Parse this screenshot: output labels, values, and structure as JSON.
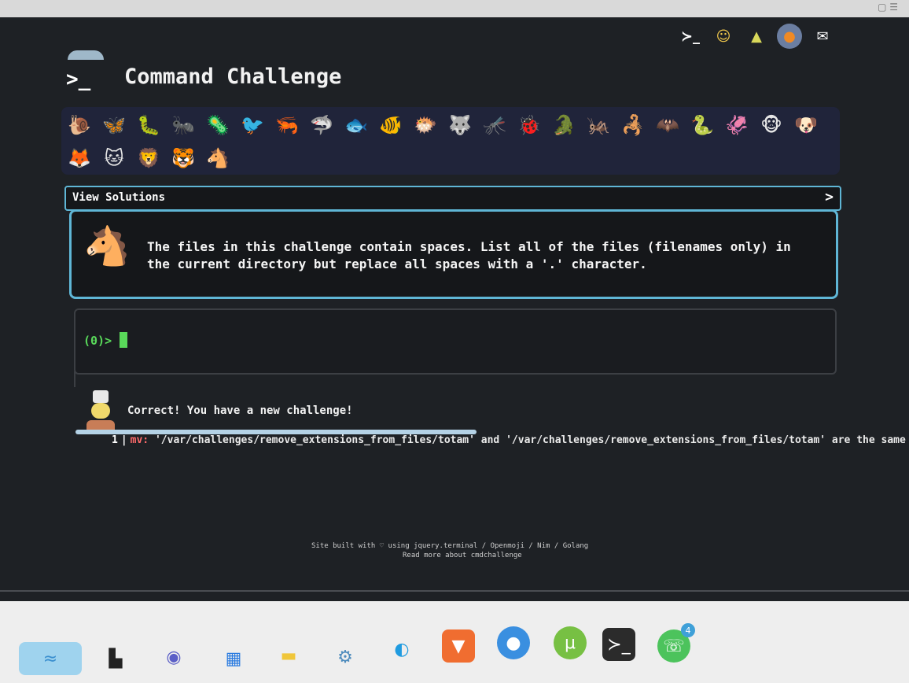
{
  "topbar": {
    "icons": [
      "terminal-icon",
      "emoji-icon",
      "tree-icon",
      "fox-badge-icon",
      "mail-icon"
    ]
  },
  "app": {
    "logo_prompt": ">_",
    "title": "Command Challenge"
  },
  "emoji_bar": {
    "row1": [
      "🐌",
      "🦋",
      "🐛",
      "🐜",
      "🦠",
      "🐦",
      "🦐",
      "🦈",
      "🐟",
      "🐠",
      "🐡",
      "🐺",
      "🦟",
      "🐞",
      "🐊",
      "🦗",
      "🦂",
      "🦇",
      "🐍",
      "🦑",
      "🐵",
      "🐶"
    ],
    "row2": [
      "🦊",
      "🐱",
      "🦁",
      "🐯",
      "🐴"
    ]
  },
  "solutions": {
    "label": "View Solutions",
    "chevron": ">"
  },
  "challenge": {
    "avatar": "🐴",
    "text": "The files in this challenge contain spaces. List all of the files (filenames only) in the current directory but replace all spaces with a '.' character."
  },
  "terminal": {
    "prompt": "(0)>"
  },
  "result": {
    "message": "Correct! You have a new challenge!"
  },
  "error": {
    "line_no": "1",
    "cmd": "mv:",
    "text": " '/var/challenges/remove_extensions_from_files/totam' and '/var/challenges/remove_extensions_from_files/totam' are the same file"
  },
  "footer": {
    "line1": "Site built with ♡ using jquery.terminal / Openmoji / Nim / Golang",
    "line2": "Read more about cmdchallenge"
  },
  "taskbar": {
    "items": [
      "widgets-icon",
      "file-explorer-alt-icon",
      "teams-icon",
      "store-icon",
      "folder-icon",
      "settings-icon",
      "edge-icon",
      "brave-icon",
      "chat-icon",
      "utorrent-icon",
      "terminal-icon",
      "whatsapp-icon"
    ],
    "badge_count": "4",
    "colors": {
      "accent": "#5fb6d6",
      "prompt_green": "#59d95a"
    }
  }
}
